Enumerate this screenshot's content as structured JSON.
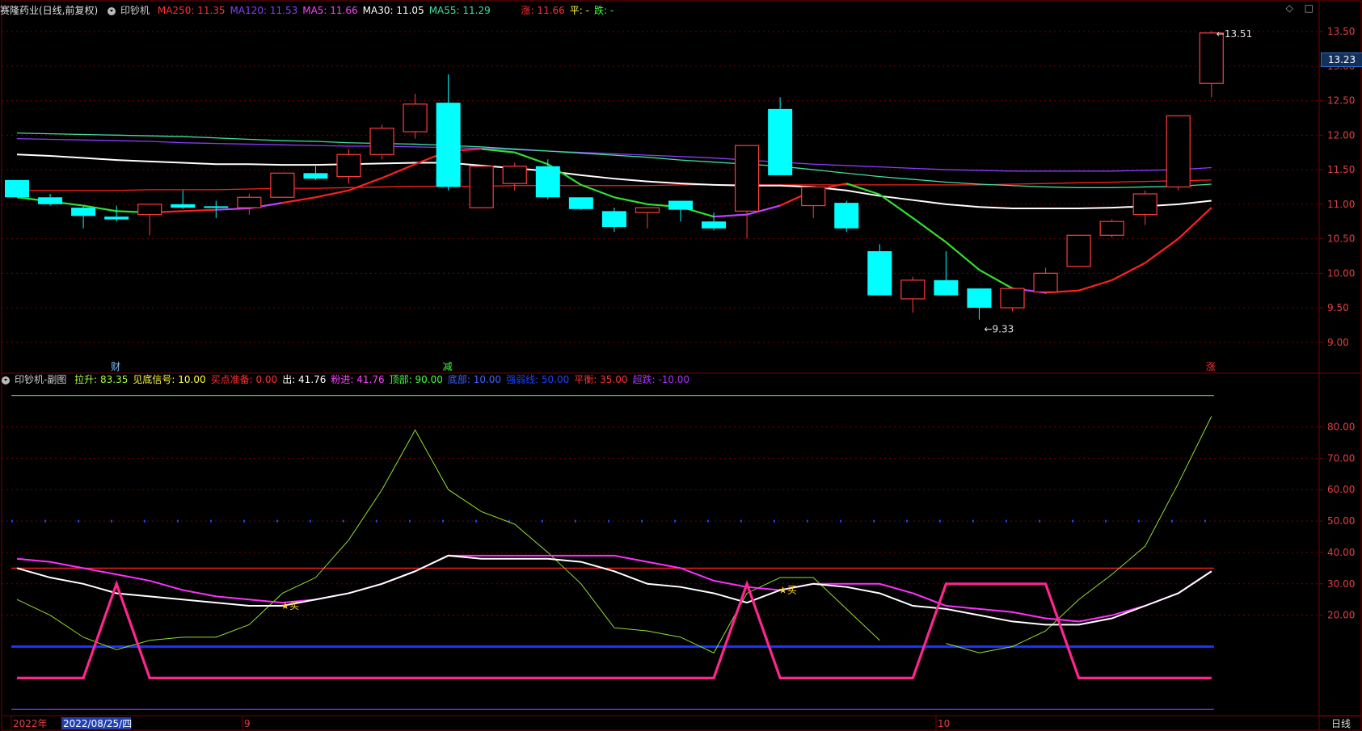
{
  "main_header": {
    "title": "赛隆药业(日线,前复权)",
    "indicator_name": "印钞机",
    "ma_items": [
      {
        "label": "MA250: 11.35",
        "color": "#ff3030"
      },
      {
        "label": "MA120: 11.53",
        "color": "#8a3cff"
      },
      {
        "label": "MA5: 11.66",
        "color": "#ff40ff"
      },
      {
        "label": "MA30: 11.05",
        "color": "#ffffff"
      },
      {
        "label": "MA55: 11.29",
        "color": "#40e0a0"
      }
    ],
    "status_items": [
      {
        "label": "涨: 11.66",
        "color": "#ff3030"
      },
      {
        "label": "平: -",
        "color": "#ffff40"
      },
      {
        "label": "跌: -",
        "color": "#40ff40"
      }
    ]
  },
  "top_icons": {
    "diamond": "◇",
    "square": "□"
  },
  "sub_header": {
    "title": "印钞机-副图",
    "items": [
      {
        "label": "拉升: 83.35",
        "color": "#a0ff40"
      },
      {
        "label": "见底信号: 10.00",
        "color": "#ffff40"
      },
      {
        "label": "买点准备: 0.00",
        "color": "#ff3030"
      },
      {
        "label": "出: 41.76",
        "color": "#ffffff"
      },
      {
        "label": "粉进: 41.76",
        "color": "#ff40ff"
      },
      {
        "label": "顶部: 90.00",
        "color": "#40ff40"
      },
      {
        "label": "底部: 10.00",
        "color": "#4060ff"
      },
      {
        "label": "强弱线: 50.00",
        "color": "#2040ff"
      },
      {
        "label": "平衡: 35.00",
        "color": "#ff3030"
      },
      {
        "label": "超跌: -10.00",
        "color": "#b030ff"
      }
    ]
  },
  "price_tag": "13.23",
  "period_label": "日线",
  "colors": {
    "up": "#ff3c3c",
    "down": "#00ffff",
    "grid": "#7a0000",
    "axis_text": "#e04040"
  },
  "chart_data": [
    {
      "type": "candlestick",
      "title": "赛隆药业(日线,前复权)",
      "ylim": [
        8.6,
        13.7
      ],
      "y_ticks": [
        "13.50",
        "13.00",
        "12.50",
        "12.00",
        "11.50",
        "11.00",
        "10.50",
        "10.00",
        "9.50",
        "9.00"
      ],
      "candles": [
        {
          "o": 11.35,
          "h": 11.35,
          "l": 11.1,
          "c": 11.1
        },
        {
          "o": 11.1,
          "h": 11.15,
          "l": 10.98,
          "c": 11.0
        },
        {
          "o": 10.95,
          "h": 10.97,
          "l": 10.65,
          "c": 10.83
        },
        {
          "o": 10.82,
          "h": 10.98,
          "l": 10.75,
          "c": 10.78
        },
        {
          "o": 10.85,
          "h": 11.0,
          "l": 10.55,
          "c": 11.0
        },
        {
          "o": 11.0,
          "h": 11.2,
          "l": 10.93,
          "c": 10.95
        },
        {
          "o": 10.97,
          "h": 11.05,
          "l": 10.8,
          "c": 10.95
        },
        {
          "o": 10.95,
          "h": 11.15,
          "l": 10.85,
          "c": 11.1
        },
        {
          "o": 11.1,
          "h": 11.45,
          "l": 11.1,
          "c": 11.45
        },
        {
          "o": 11.45,
          "h": 11.55,
          "l": 11.35,
          "c": 11.37
        },
        {
          "o": 11.4,
          "h": 11.8,
          "l": 11.3,
          "c": 11.72
        },
        {
          "o": 11.72,
          "h": 12.15,
          "l": 11.65,
          "c": 12.1
        },
        {
          "o": 12.05,
          "h": 12.6,
          "l": 11.95,
          "c": 12.45
        },
        {
          "o": 12.47,
          "h": 12.88,
          "l": 11.2,
          "c": 11.25
        },
        {
          "o": 10.95,
          "h": 11.55,
          "l": 10.95,
          "c": 11.55
        },
        {
          "o": 11.3,
          "h": 11.6,
          "l": 11.2,
          "c": 11.55
        },
        {
          "o": 11.55,
          "h": 11.65,
          "l": 11.07,
          "c": 11.1
        },
        {
          "o": 11.1,
          "h": 11.1,
          "l": 10.92,
          "c": 10.93
        },
        {
          "o": 10.9,
          "h": 10.95,
          "l": 10.6,
          "c": 10.67
        },
        {
          "o": 10.88,
          "h": 10.95,
          "l": 10.65,
          "c": 10.95
        },
        {
          "o": 11.05,
          "h": 11.05,
          "l": 10.75,
          "c": 10.92
        },
        {
          "o": 10.75,
          "h": 10.88,
          "l": 10.62,
          "c": 10.65
        },
        {
          "o": 10.9,
          "h": 11.85,
          "l": 10.5,
          "c": 11.85
        },
        {
          "o": 12.38,
          "h": 12.55,
          "l": 11.45,
          "c": 11.42
        },
        {
          "o": 10.98,
          "h": 11.25,
          "l": 10.8,
          "c": 11.25
        },
        {
          "o": 11.02,
          "h": 11.05,
          "l": 10.6,
          "c": 10.65
        },
        {
          "o": 10.32,
          "h": 10.42,
          "l": 9.68,
          "c": 9.68
        },
        {
          "o": 9.63,
          "h": 9.95,
          "l": 9.43,
          "c": 9.9
        },
        {
          "o": 9.9,
          "h": 10.32,
          "l": 9.7,
          "c": 9.68
        },
        {
          "o": 9.78,
          "h": 9.78,
          "l": 9.33,
          "c": 9.5
        },
        {
          "o": 9.5,
          "h": 9.8,
          "l": 9.45,
          "c": 9.78
        },
        {
          "o": 9.73,
          "h": 10.08,
          "l": 9.7,
          "c": 10.0
        },
        {
          "o": 10.1,
          "h": 10.55,
          "l": 10.1,
          "c": 10.55
        },
        {
          "o": 10.55,
          "h": 10.78,
          "l": 10.52,
          "c": 10.75
        },
        {
          "o": 10.85,
          "h": 11.2,
          "l": 10.7,
          "c": 11.15
        },
        {
          "o": 11.25,
          "h": 12.28,
          "l": 11.2,
          "c": 12.28
        },
        {
          "o": 12.75,
          "h": 13.51,
          "l": 12.55,
          "c": 13.48
        }
      ],
      "series": [
        {
          "name": "MA250",
          "values": [
            11.2,
            11.2,
            11.2,
            11.2,
            11.21,
            11.21,
            11.21,
            11.22,
            11.23,
            11.23,
            11.24,
            11.25,
            11.26,
            11.26,
            11.26,
            11.27,
            11.27,
            11.27,
            11.27,
            11.27,
            11.28,
            11.28,
            11.28,
            11.28,
            11.28,
            11.28,
            11.28,
            11.28,
            11.28,
            11.28,
            11.29,
            11.3,
            11.31,
            11.32,
            11.33,
            11.34,
            11.35
          ]
        },
        {
          "name": "MA120",
          "values": [
            11.95,
            11.94,
            11.93,
            11.92,
            11.91,
            11.89,
            11.88,
            11.87,
            11.86,
            11.85,
            11.84,
            11.84,
            11.83,
            11.82,
            11.81,
            11.79,
            11.77,
            11.75,
            11.73,
            11.71,
            11.69,
            11.67,
            11.64,
            11.61,
            11.58,
            11.56,
            11.54,
            11.52,
            11.5,
            11.49,
            11.48,
            11.48,
            11.48,
            11.48,
            11.49,
            11.5,
            11.53
          ]
        },
        {
          "name": "MA55",
          "values": [
            12.03,
            12.02,
            12.01,
            12.0,
            11.99,
            11.98,
            11.96,
            11.94,
            11.92,
            11.91,
            11.89,
            11.88,
            11.87,
            11.85,
            11.83,
            11.8,
            11.77,
            11.74,
            11.71,
            11.68,
            11.64,
            11.61,
            11.58,
            11.55,
            11.5,
            11.45,
            11.4,
            11.36,
            11.32,
            11.29,
            11.27,
            11.25,
            11.24,
            11.24,
            11.25,
            11.26,
            11.29
          ]
        },
        {
          "name": "MA30",
          "values": [
            11.72,
            11.7,
            11.67,
            11.64,
            11.62,
            11.6,
            11.58,
            11.58,
            11.57,
            11.57,
            11.58,
            11.59,
            11.6,
            11.6,
            11.56,
            11.52,
            11.48,
            11.42,
            11.37,
            11.33,
            11.3,
            11.28,
            11.27,
            11.27,
            11.25,
            11.2,
            11.12,
            11.06,
            11.0,
            10.96,
            10.94,
            10.94,
            10.94,
            10.95,
            10.97,
            11.0,
            11.05
          ]
        },
        {
          "name": "MA5",
          "values": [
            11.1,
            11.04,
            10.98,
            10.9,
            10.88,
            10.9,
            10.92,
            10.94,
            11.02,
            11.1,
            11.2,
            11.38,
            11.58,
            11.77,
            11.8,
            11.75,
            11.58,
            11.28,
            11.1,
            11.0,
            10.96,
            10.82,
            10.85,
            10.98,
            11.2,
            11.3,
            11.14,
            10.8,
            10.45,
            10.05,
            9.78,
            9.72,
            9.75,
            9.9,
            10.15,
            10.5,
            10.95
          ]
        }
      ],
      "annotations": [
        {
          "label": "13.51",
          "candle": 36,
          "value": 13.51
        },
        {
          "label": "9.33",
          "candle": 29,
          "value": 9.33
        }
      ],
      "markers": [
        {
          "label": "财",
          "candle": 3
        },
        {
          "label": "减",
          "candle": 13
        },
        {
          "label": "涨",
          "candle": 36
        }
      ]
    },
    {
      "type": "line",
      "title": "印钞机-副图",
      "ylim": [
        -12,
        93
      ],
      "y_ticks": [
        "80.00",
        "70.00",
        "60.00",
        "50.00",
        "40.00",
        "30.00",
        "20.00"
      ],
      "x_labels": [
        "2022年",
        "2022/08/25/四",
        "9",
        "10"
      ],
      "series": [
        {
          "name": "拉升",
          "values": [
            25,
            20,
            13,
            9,
            12,
            13,
            13,
            17,
            27,
            32,
            44,
            60,
            79,
            60,
            53,
            49,
            40,
            30,
            16,
            15,
            13,
            8,
            27,
            32,
            32,
            22,
            12,
            null,
            11,
            8,
            10,
            15,
            25,
            33,
            42,
            62,
            83.35
          ]
        },
        {
          "name": "粉进",
          "values": [
            38,
            37,
            35,
            33,
            31,
            28,
            26,
            25,
            24,
            25,
            27,
            30,
            34,
            39,
            39,
            39,
            39,
            39,
            39,
            37,
            35,
            31,
            29,
            28,
            30,
            30,
            30,
            27,
            23,
            22,
            21,
            19,
            18,
            20,
            23,
            27,
            34,
            41.76
          ]
        },
        {
          "name": "出",
          "values": [
            35,
            32,
            30,
            27,
            26,
            25,
            24,
            23,
            23,
            25,
            27,
            30,
            34,
            39,
            38,
            38,
            38,
            37,
            34,
            30,
            29,
            27,
            24,
            28,
            30,
            29,
            27,
            23,
            22,
            20,
            18,
            17,
            17,
            19,
            23,
            27,
            34,
            41.76
          ]
        },
        {
          "name": "买点准备",
          "values": [
            0,
            0,
            0,
            30,
            0,
            0,
            0,
            0,
            0,
            0,
            0,
            0,
            0,
            0,
            0,
            0,
            0,
            0,
            0,
            0,
            0,
            0,
            30,
            0,
            0,
            0,
            0,
            0,
            30,
            30,
            30,
            30,
            0,
            0,
            0,
            0,
            0,
            0
          ]
        }
      ],
      "reference_lines": [
        {
          "name": "顶部",
          "value": 90
        },
        {
          "name": "强弱线",
          "value": 50
        },
        {
          "name": "平衡",
          "value": 35
        },
        {
          "name": "底部",
          "value": 10
        },
        {
          "name": "超跌",
          "value": -10
        }
      ],
      "markers": [
        {
          "label": "★买",
          "index": 8
        },
        {
          "label": "★买",
          "index": 23
        }
      ]
    }
  ]
}
